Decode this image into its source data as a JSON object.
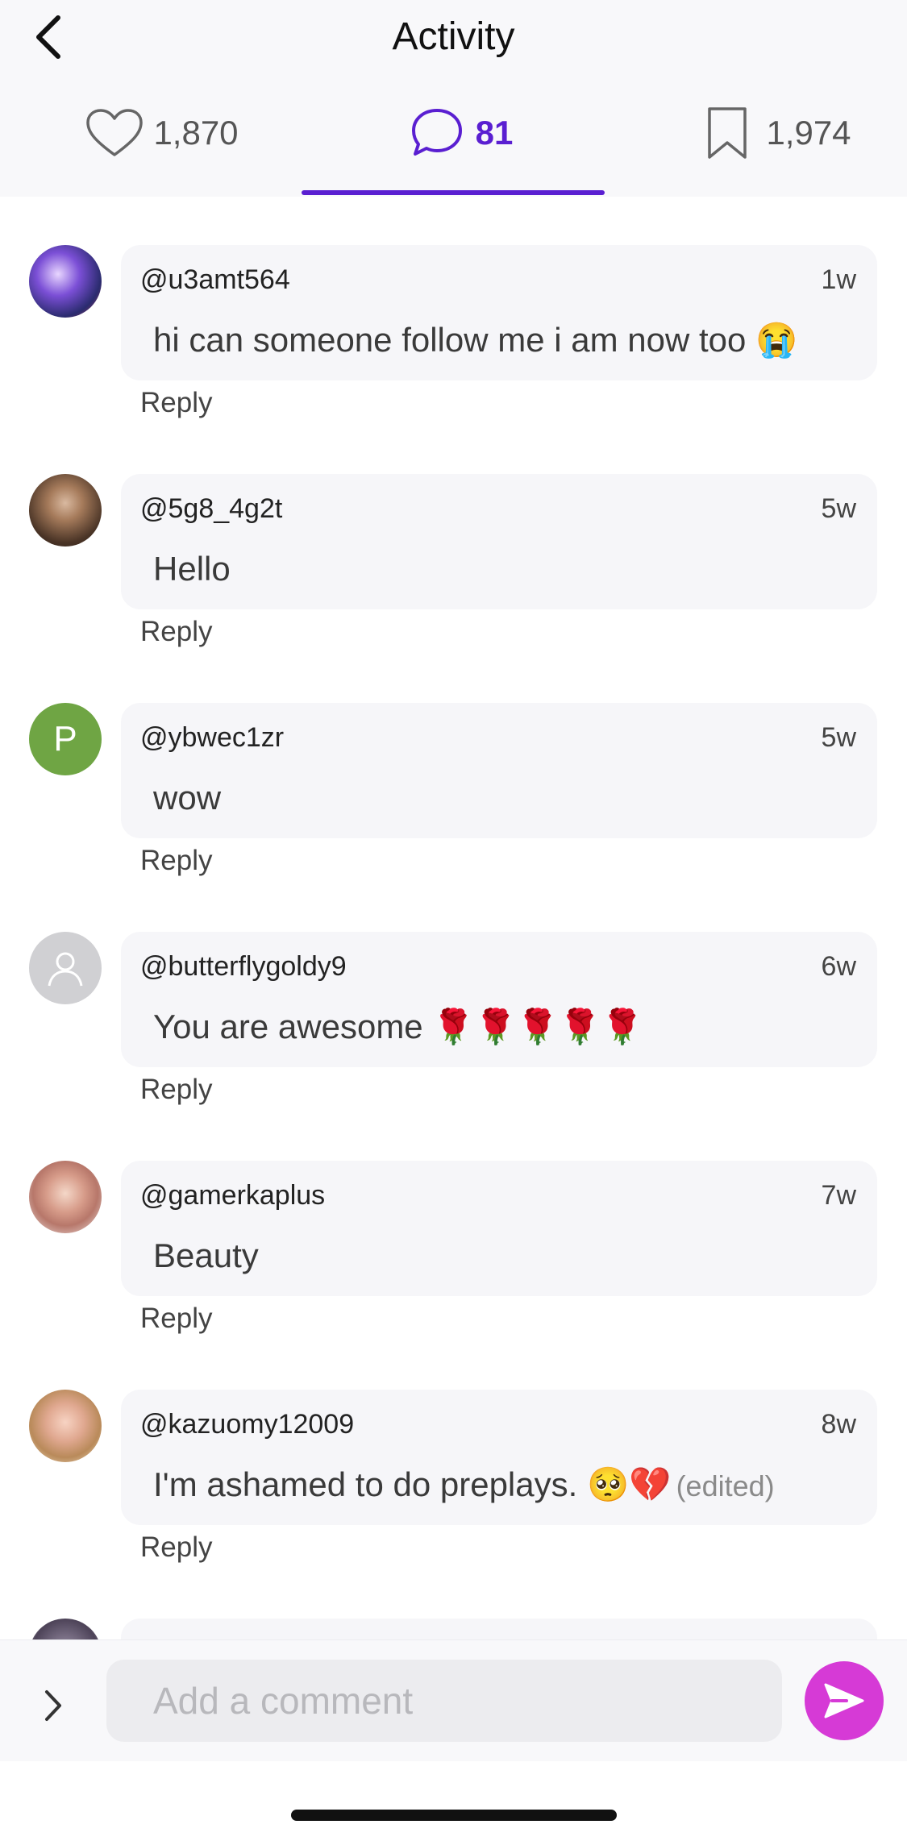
{
  "header": {
    "title": "Activity"
  },
  "tabs": [
    {
      "icon": "heart-icon",
      "count": "1,870"
    },
    {
      "icon": "comment-icon",
      "count": "81",
      "active": true
    },
    {
      "icon": "bookmark-icon",
      "count": "1,974"
    }
  ],
  "colors": {
    "accent": "#5a1fd1",
    "send": "#d63ad6",
    "bubble": "#f6f6f9"
  },
  "comments": [
    {
      "user": "@u3amt564",
      "time": "1w",
      "text": "hi can someone follow me i am now too 😭",
      "reply": "Reply"
    },
    {
      "user": "@5g8_4g2t",
      "time": "5w",
      "text": "Hello",
      "reply": "Reply"
    },
    {
      "user": "@ybwec1zr",
      "time": "5w",
      "text": "wow",
      "reply": "Reply",
      "avatar_letter": "P"
    },
    {
      "user": "@butterflygoldy9",
      "time": "6w",
      "text": "You are awesome 🌹🌹🌹🌹🌹",
      "reply": "Reply"
    },
    {
      "user": "@gamerkaplus",
      "time": "7w",
      "text": "Beauty",
      "reply": "Reply"
    },
    {
      "user": "@kazuomy12009",
      "time": "8w",
      "text": "I'm ashamed to do preplays. 🥺💔",
      "edited": "(edited)",
      "reply": "Reply"
    }
  ],
  "composer": {
    "placeholder": "Add a comment"
  }
}
